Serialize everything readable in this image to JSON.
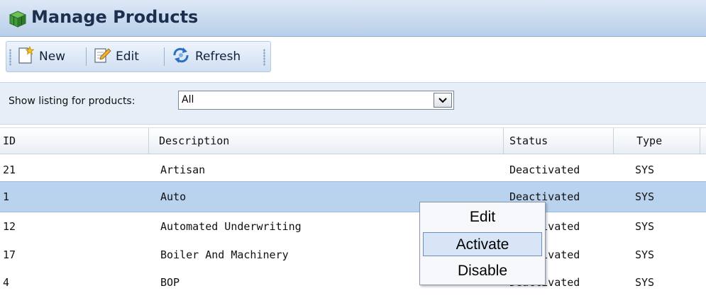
{
  "title": "Manage Products",
  "toolbar": {
    "new_label": "New",
    "edit_label": "Edit",
    "refresh_label": "Refresh"
  },
  "filter": {
    "label": "Show listing for products:",
    "value": "All"
  },
  "grid": {
    "columns": [
      "ID",
      "Description",
      "Status",
      "Type"
    ],
    "rows": [
      {
        "id": "21",
        "description": "Artisan",
        "status": "Deactivated",
        "type": "SYS",
        "selected": false
      },
      {
        "id": "1",
        "description": "Auto",
        "status": "Deactivated",
        "type": "SYS",
        "selected": true
      },
      {
        "id": "12",
        "description": "Automated Underwriting",
        "status": "Deactivated",
        "type": "SYS",
        "selected": false
      },
      {
        "id": "17",
        "description": "Boiler And Machinery",
        "status": "Deactivated",
        "type": "SYS",
        "selected": false
      },
      {
        "id": "4",
        "description": "BOP",
        "status": "Deactivated",
        "type": "SYS",
        "selected": false
      }
    ]
  },
  "context_menu": {
    "items": [
      "Edit",
      "Activate",
      "Disable"
    ],
    "highlighted": "Activate"
  },
  "colors": {
    "header_blue": "#b9cfea",
    "selected_row": "#b9d2ee",
    "title_text": "#1d2f4e"
  }
}
